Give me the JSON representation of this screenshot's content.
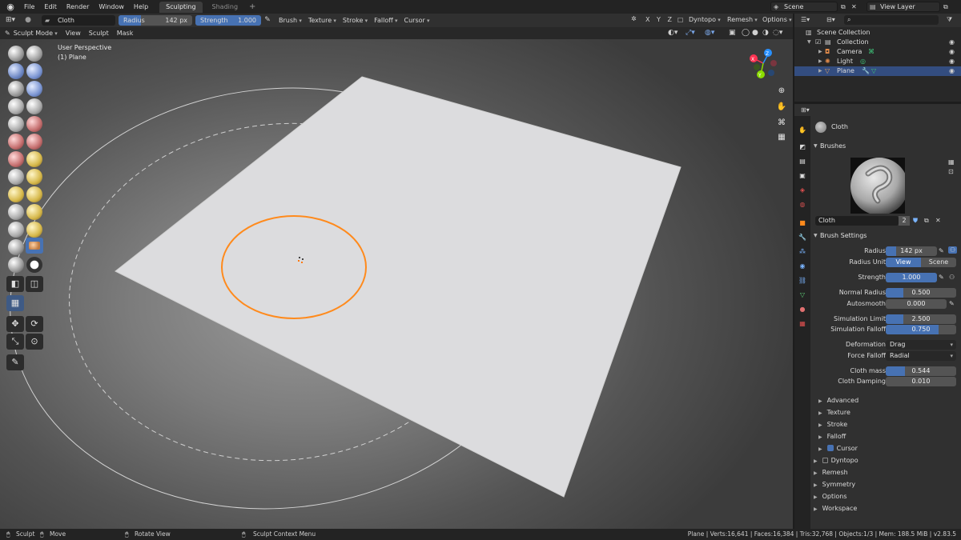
{
  "topbar": {
    "menus": [
      "File",
      "Edit",
      "Render",
      "Window",
      "Help"
    ],
    "workspaces": [
      "Sculpting",
      "Shading"
    ],
    "active_workspace": "Sculpting",
    "add_workspace": "+",
    "scene": "Scene",
    "view_layer": "View Layer"
  },
  "header": {
    "brush_name": "Cloth",
    "radius_label": "Radius",
    "radius_value": "142 px",
    "strength_label": "Strength",
    "strength_value": "1.000",
    "menus": [
      "Brush",
      "Texture",
      "Stroke",
      "Falloff",
      "Cursor"
    ],
    "axes": "X Y Z",
    "dyntopo": "Dyntopo",
    "remesh": "Remesh",
    "options": "Options"
  },
  "header2": {
    "mode": "Sculpt Mode",
    "menus": [
      "View",
      "Sculpt",
      "Mask"
    ]
  },
  "viewport": {
    "perspective": "User Perspective",
    "object": "(1) Plane",
    "gizmo": {
      "x": "X",
      "y": "Y",
      "z": "Z"
    }
  },
  "outliner": {
    "root": "Scene Collection",
    "collection": "Collection",
    "items": [
      "Camera",
      "Light",
      "Plane"
    ],
    "selected": "Plane"
  },
  "properties": {
    "brush_name": "Cloth",
    "panel_brushes": "Brushes",
    "brush_field": "Cloth",
    "brush_users": "2",
    "panel_brush_settings": "Brush Settings",
    "radius_label": "Radius",
    "radius_value": "142 px",
    "radius_unit_label": "Radius Unit",
    "radius_unit_view": "View",
    "radius_unit_scene": "Scene",
    "strength_label": "Strength",
    "strength_value": "1.000",
    "normal_radius_label": "Normal Radius",
    "normal_radius_value": "0.500",
    "autosmooth_label": "Autosmooth",
    "autosmooth_value": "0.000",
    "sim_limit_label": "Simulation Limit",
    "sim_limit_value": "2.500",
    "sim_falloff_label": "Simulation Falloff",
    "sim_falloff_value": "0.750",
    "deformation_label": "Deformation",
    "deformation_value": "Drag",
    "force_falloff_label": "Force Falloff",
    "force_falloff_value": "Radial",
    "cloth_mass_label": "Cloth mass",
    "cloth_mass_value": "0.544",
    "cloth_damping_label": "Cloth Damping",
    "cloth_damping_value": "0.010",
    "subpanels": [
      "Advanced",
      "Texture",
      "Stroke",
      "Falloff",
      "Cursor"
    ],
    "panels": [
      "Dyntopo",
      "Remesh",
      "Symmetry",
      "Options",
      "Workspace"
    ]
  },
  "fills": {
    "header_radius": 0.3,
    "radius": 0.2,
    "strength": 1.0,
    "normal_radius": 0.25,
    "autosmooth": 0.0,
    "sim_limit": 0.25,
    "sim_falloff": 0.75,
    "cloth_mass": 0.27,
    "cloth_damping": 0.0
  },
  "status": {
    "sculpt": "Sculpt",
    "move": "Move",
    "rotate": "Rotate View",
    "context": "Sculpt Context Menu",
    "stats": "Plane | Verts:16,641 | Faces:16,384 | Tris:32,768 | Objects:1/3 | Mem: 188.5 MiB | v2.83.5"
  },
  "colors": {
    "accent": "#4772b3",
    "brush_circle": "#ff8a1c",
    "selected_row": "#334d80",
    "axis_x": "#ff3352",
    "axis_y": "#8bdc00",
    "axis_z": "#2890ff"
  }
}
